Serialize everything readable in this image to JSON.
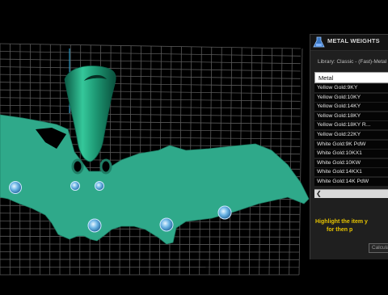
{
  "panel": {
    "title": "METAL WEIGHTS",
    "library_label": "Library: Classic - (Fast)-Metal",
    "column_header": "Metal",
    "metals": [
      "Yellow Gold:9KY",
      "Yellow Gold:10KY",
      "Yellow Gold:14KY",
      "Yellow Gold:18KY",
      "Yellow Gold:18KY R...",
      "Yellow Gold:22KY",
      "White Gold:9K PdW",
      "White Gold:10KX1",
      "White Gold:10KW",
      "White Gold:14KX1",
      "White Gold:14K PdW"
    ],
    "scroll_left_icon": "chevron-left-icon",
    "instruction_line1": "Highlight the item y",
    "instruction_line2": "for then p",
    "calculate_label": "Calcula"
  },
  "colors": {
    "model_green": "#2fa98a",
    "grid_line": "#5a5a5a",
    "gem_blue": "#5aa7d8",
    "instruction_yellow": "#e7c400"
  }
}
